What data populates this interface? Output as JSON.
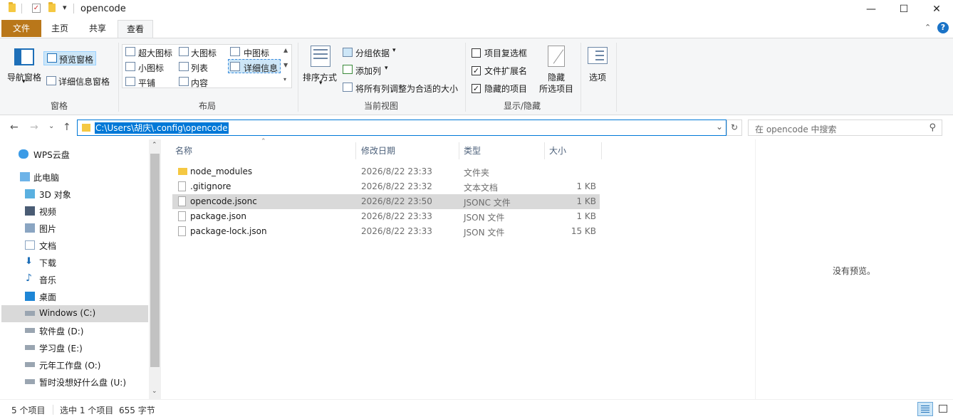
{
  "window": {
    "title": "opencode",
    "minimize": "—",
    "maximize": "☐",
    "close": "✕"
  },
  "tabs": {
    "file": "文件",
    "home": "主页",
    "share": "共享",
    "view": "查看"
  },
  "ribbon": {
    "panes": {
      "nav_pane": "导航窗格",
      "preview_pane": "预览窗格",
      "details_pane": "详细信息窗格",
      "group": "窗格"
    },
    "layout": {
      "extra_large": "超大图标",
      "large": "大图标",
      "medium": "中图标",
      "small": "小图标",
      "list": "列表",
      "details": "详细信息",
      "tiles": "平铺",
      "content": "内容",
      "group": "布局"
    },
    "current_view": {
      "sort_by": "排序方式",
      "group_by": "分组依据",
      "add_columns": "添加列",
      "fit_columns": "将所有列调整为合适的大小",
      "group": "当前视图"
    },
    "show_hide": {
      "item_checkboxes": "项目复选框",
      "file_extensions": "文件扩展名",
      "hidden_items": "隐藏的项目",
      "hide_selected": "隐藏",
      "hide_selected_2": "所选项目",
      "group": "显示/隐藏"
    },
    "options": "选项"
  },
  "address": {
    "path": "C:\\Users\\胡庆\\.config\\opencode",
    "search_placeholder": "在 opencode 中搜索"
  },
  "nav": {
    "items": [
      {
        "label": "WPS云盘"
      },
      {
        "label": "此电脑"
      },
      {
        "label": "3D 对象"
      },
      {
        "label": "视频"
      },
      {
        "label": "图片"
      },
      {
        "label": "文档"
      },
      {
        "label": "下载"
      },
      {
        "label": "音乐"
      },
      {
        "label": "桌面"
      },
      {
        "label": "Windows (C:)"
      },
      {
        "label": "软件盘 (D:)"
      },
      {
        "label": "学习盘 (E:)"
      },
      {
        "label": "元年工作盘 (O:)"
      },
      {
        "label": "暂时没想好什么盘 (U:)"
      }
    ]
  },
  "filelist": {
    "columns": {
      "name": "名称",
      "modified": "修改日期",
      "type": "类型",
      "size": "大小"
    },
    "rows": [
      {
        "name": "node_modules",
        "modified": "2026/8/22 23:33",
        "type": "文件夹",
        "size": ""
      },
      {
        "name": ".gitignore",
        "modified": "2026/8/22 23:32",
        "type": "文本文档",
        "size": "1 KB"
      },
      {
        "name": "opencode.jsonc",
        "modified": "2026/8/22 23:50",
        "type": "JSONC 文件",
        "size": "1 KB"
      },
      {
        "name": "package.json",
        "modified": "2026/8/22 23:33",
        "type": "JSON 文件",
        "size": "1 KB"
      },
      {
        "name": "package-lock.json",
        "modified": "2026/8/22 23:33",
        "type": "JSON 文件",
        "size": "15 KB"
      }
    ]
  },
  "preview": {
    "empty_text": "没有预览。"
  },
  "status": {
    "item_count": "5 个项目",
    "selected": "选中 1 个项目",
    "size": "655 字节"
  },
  "colors": {
    "file_tab": "#b9771a",
    "selection": "#0078d7",
    "row_selected": "#d9d9d9"
  }
}
